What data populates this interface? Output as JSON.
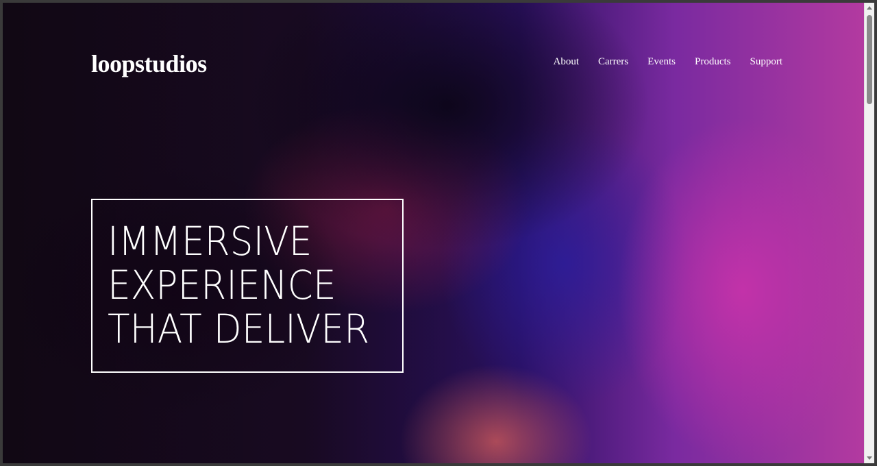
{
  "brand": {
    "logo_text": "loopstudios"
  },
  "nav": {
    "items": [
      {
        "label": "About"
      },
      {
        "label": "Carrers"
      },
      {
        "label": "Events"
      },
      {
        "label": "Products"
      },
      {
        "label": "Support"
      }
    ]
  },
  "hero": {
    "headline_lines": [
      "IMMERSIVE",
      "EXPERIENCE",
      "THAT DELIVER"
    ]
  },
  "colors": {
    "text": "#ffffff",
    "hero_magenta": "#b33aa0",
    "hero_dark": "#160a1a"
  },
  "icons": {
    "scroll_up": "triangle-up",
    "scroll_down": "triangle-down"
  }
}
